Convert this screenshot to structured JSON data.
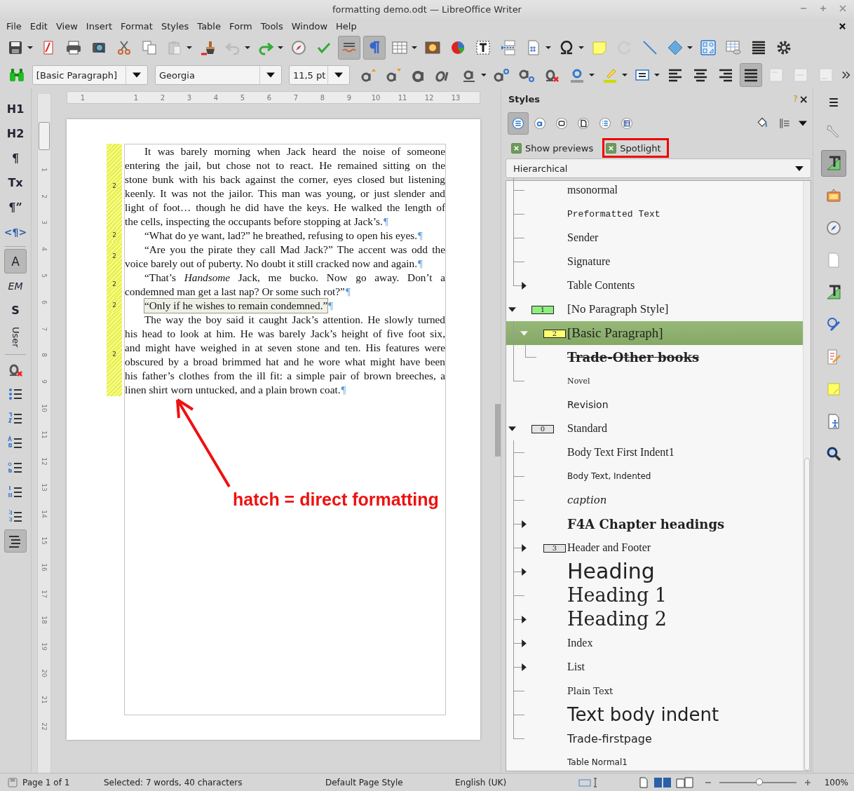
{
  "window": {
    "title": "formatting demo.odt — LibreOffice Writer"
  },
  "menu": [
    "File",
    "Edit",
    "View",
    "Insert",
    "Format",
    "Styles",
    "Table",
    "Form",
    "Tools",
    "Window",
    "Help"
  ],
  "toolbar_toggles": {
    "auto_spellcheck": true,
    "formatting_marks": true,
    "justified": true
  },
  "formatting_bar": {
    "paragraph_style": "[Basic Paragraph]",
    "font": "Georgia",
    "size": "11,5 pt"
  },
  "left_sidebar": {
    "items": [
      {
        "label": "H1",
        "selected": false
      },
      {
        "label": "H2",
        "selected": false
      },
      {
        "label": "¶",
        "selected": false
      },
      {
        "label": "Tx",
        "selected": false
      },
      {
        "label": "¶”",
        "selected": false
      },
      {
        "label": "<¶>",
        "selected": false
      },
      {
        "label": "A",
        "selected": true
      },
      {
        "label": "EM",
        "selected": false
      },
      {
        "label": "S",
        "selected": false
      },
      {
        "label": "User",
        "selected": false
      }
    ],
    "list_buttons": [
      {
        "selected": false
      },
      {
        "selected": false
      },
      {
        "selected": false
      },
      {
        "selected": false
      },
      {
        "selected": false
      },
      {
        "selected": false
      },
      {
        "selected": true
      }
    ]
  },
  "rulers": {
    "horizontal": [
      "1",
      "1",
      "2",
      "3",
      "4",
      "5",
      "6",
      "7",
      "8",
      "9",
      "10",
      "11",
      "12",
      "13"
    ],
    "vertical": [
      "1",
      "2",
      "3",
      "4",
      "5",
      "6",
      "7",
      "8",
      "9",
      "10",
      "11",
      "12",
      "13",
      "14",
      "15",
      "16",
      "17",
      "18",
      "19",
      "20",
      "21",
      "22"
    ]
  },
  "document": {
    "paragraphs": [
      {
        "style_number": "2",
        "selected": false,
        "end_mark": "¶",
        "lines": [
          "It was barely morning when Jack heard the noise of someone",
          "entering the jail, but chose not to react. He remained sitting on the",
          "stone bunk with his back against the corner, eyes closed but listening",
          "keenly. It was not the jailor. This man was young, or just slender and",
          "light of foot… though he did have the keys. He walked the length of",
          "the cells, inspecting the occupants before stopping at Jack’s."
        ]
      },
      {
        "style_number": "2",
        "selected": false,
        "end_mark": "¶",
        "lines": [
          "“What do ye want, lad?” he breathed, refusing to open his eyes."
        ]
      },
      {
        "style_number": "2",
        "selected": false,
        "end_mark": "¶",
        "lines": [
          "“Are you the pirate they call Mad Jack?” The accent was odd the",
          "voice barely out of puberty. No doubt it still cracked now and again."
        ]
      },
      {
        "style_number": "2",
        "selected": false,
        "end_mark": "¶",
        "lines": [
          "“That’s *Handsome* Jack, me bucko. Now go away. Don’t a",
          "condemned man get a last nap? Or some such rot?”"
        ]
      },
      {
        "style_number": "2",
        "selected": true,
        "end_mark": "¶",
        "lines": [
          "“Only if he wishes to remain condemned.”"
        ]
      },
      {
        "style_number": "2",
        "selected": false,
        "end_mark": "¶",
        "lines": [
          "The way the boy said it caught Jack’s attention. He slowly turned",
          "his head to look at him. He was barely Jack’s height of five foot six,",
          "and might have weighed in at seven stone and ten. His features were",
          "obscured by a broad brimmed hat and he wore what might have been",
          "his father’s clothes from the ill fit: a simple pair of brown breeches, a",
          "linen shirt worn untucked, and a plain brown coat."
        ]
      }
    ]
  },
  "annotation": {
    "text": "hatch = direct formatting"
  },
  "styles_panel": {
    "title": "Styles",
    "help": "?",
    "close": "×",
    "categories": [
      {
        "selected": true
      },
      {
        "selected": false
      },
      {
        "selected": false
      },
      {
        "selected": false
      },
      {
        "selected": false
      },
      {
        "selected": false
      }
    ],
    "options": [
      {
        "label": "Show previews",
        "checked": true,
        "highlighted": false
      },
      {
        "label": "Spotlight",
        "checked": true,
        "highlighted": true
      }
    ],
    "filter": "Hierarchical",
    "tree": [
      {
        "children": [
          {
            "name": "msonormal",
            "kind": "serif"
          },
          {
            "name": "Preformatted Text",
            "kind": "mono"
          },
          {
            "name": "Sender",
            "kind": "serif"
          },
          {
            "name": "Signature",
            "kind": "serif"
          },
          {
            "name": "Table Contents",
            "kind": "serif",
            "expanded": false
          }
        ]
      },
      {
        "name": "[No Paragraph Style]",
        "kind": "serif-medium",
        "badge": "1",
        "color": "#90ee80",
        "expanded": true,
        "selected": false,
        "children": [
          {
            "name": "[Basic Paragraph]",
            "kind": "serif-large",
            "badge": "2",
            "color": "#ffff70",
            "expanded": true,
            "selected": true,
            "children": [
              {
                "name": "Trade-Other books",
                "kind": "serif-struck"
              }
            ]
          },
          {
            "name": "Novel",
            "kind": "serif-small"
          }
        ]
      },
      {
        "name": "Revision",
        "kind": "sans"
      },
      {
        "name": "Standard",
        "kind": "serif",
        "badge": "0",
        "color": "#e4e4e4",
        "expanded": true,
        "selected": false,
        "children": [
          {
            "name": "Body Text First Indent1",
            "kind": "serif"
          },
          {
            "name": "Body Text, Indented",
            "kind": "sans-small"
          },
          {
            "name": "caption",
            "kind": "serif-italic"
          },
          {
            "name": "F4A Chapter headings",
            "kind": "serif-bold",
            "expanded": false
          },
          {
            "name": "Header and Footer",
            "kind": "serif",
            "badge": "3",
            "color": "#e4e4e4",
            "expanded": false
          },
          {
            "name": "Heading",
            "kind": "sans-huge",
            "expanded": false
          },
          {
            "name": "Heading 1",
            "kind": "serif-huge"
          },
          {
            "name": "Heading 2",
            "kind": "serif-huge",
            "expanded": false
          },
          {
            "name": "Index",
            "kind": "serif",
            "expanded": false
          },
          {
            "name": "List",
            "kind": "serif",
            "expanded": false
          },
          {
            "name": "Plain Text",
            "kind": "serif-plain"
          },
          {
            "name": "Text body indent",
            "kind": "sans-big"
          },
          {
            "name": "Trade-firstpage",
            "kind": "sans-medium"
          }
        ]
      },
      {
        "name": "Table Normal1",
        "kind": "sans-small"
      }
    ]
  },
  "deck_tabs": [
    {
      "selected": false
    },
    {
      "selected": true
    },
    {
      "selected": false
    },
    {
      "selected": false
    },
    {
      "selected": false
    },
    {
      "selected": false
    },
    {
      "selected": false
    },
    {
      "selected": false
    },
    {
      "selected": false
    },
    {
      "selected": false
    },
    {
      "selected": false
    }
  ],
  "status_bar": {
    "page": "Page 1 of 1",
    "selection": "Selected: 7 words, 40 characters",
    "page_style": "Default Page Style",
    "language": "English (UK)",
    "zoom": {
      "level": 0.52,
      "reading": "100%"
    }
  }
}
